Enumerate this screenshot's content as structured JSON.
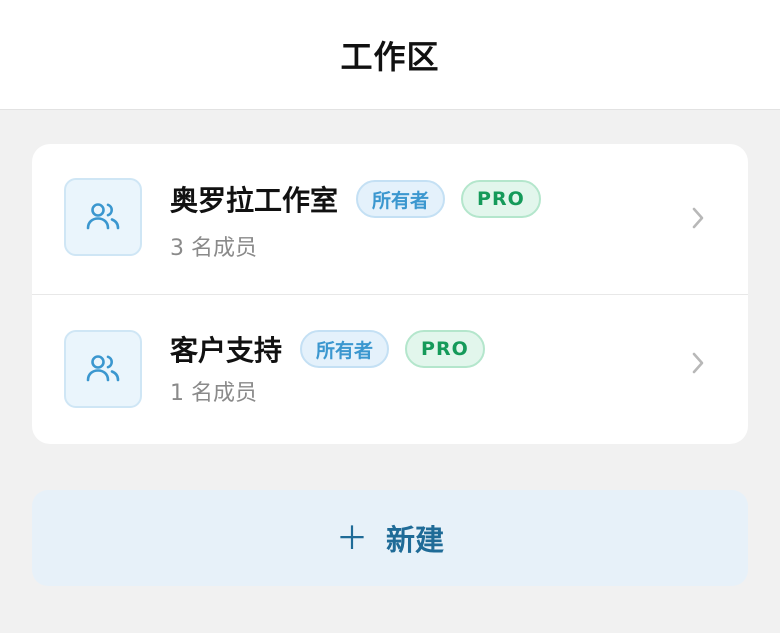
{
  "header": {
    "title": "工作区"
  },
  "workspaces": [
    {
      "name": "奥罗拉工作室",
      "role_badge": "所有者",
      "plan_badge": "PRO",
      "members": "3 名成员",
      "icon": "users-icon"
    },
    {
      "name": "客户支持",
      "role_badge": "所有者",
      "plan_badge": "PRO",
      "members": "1 名成员",
      "icon": "users-icon"
    }
  ],
  "new_button": {
    "icon": "plus-icon",
    "label": "新建"
  },
  "colors": {
    "background": "#f1f1f1",
    "accent": "#1f6b97",
    "owner_badge": "#3b97cf",
    "pro_badge": "#159a5a",
    "icon_blue": "#3b97cf"
  }
}
